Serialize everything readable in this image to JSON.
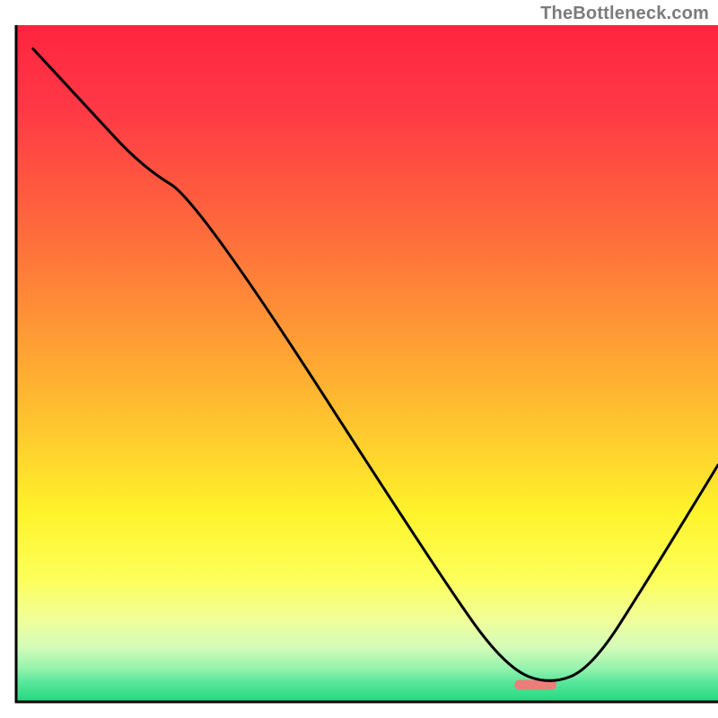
{
  "watermark": "TheBottleneck.com",
  "chart_data": {
    "type": "line",
    "title": "",
    "xlabel": "",
    "ylabel": "",
    "xlim": [
      0,
      100
    ],
    "ylim": [
      0,
      100
    ],
    "grid": false,
    "legend": false,
    "marker": {
      "x_percent": 74,
      "y_percent": 97.5,
      "width_percent": 6,
      "color": "#ec7d78"
    },
    "series": [
      {
        "name": "curve",
        "x_percent": [
          2.4,
          10,
          18,
          26,
          62,
          70,
          76,
          82,
          90,
          100
        ],
        "y_percent": [
          3.5,
          12,
          21,
          26,
          84,
          95,
          97.5,
          95,
          82,
          65
        ]
      }
    ],
    "gradient_stops": [
      {
        "offset": 0,
        "color": "#ff243f"
      },
      {
        "offset": 12,
        "color": "#ff3846"
      },
      {
        "offset": 25,
        "color": "#ff5b3f"
      },
      {
        "offset": 38,
        "color": "#ff8239"
      },
      {
        "offset": 50,
        "color": "#ffa833"
      },
      {
        "offset": 62,
        "color": "#ffcf2e"
      },
      {
        "offset": 72,
        "color": "#fff32b"
      },
      {
        "offset": 82,
        "color": "#fcff5b"
      },
      {
        "offset": 88,
        "color": "#f0ff9b"
      },
      {
        "offset": 92,
        "color": "#d2fcb9"
      },
      {
        "offset": 95,
        "color": "#97f3af"
      },
      {
        "offset": 97,
        "color": "#5be79b"
      },
      {
        "offset": 100,
        "color": "#22d97f"
      }
    ]
  }
}
